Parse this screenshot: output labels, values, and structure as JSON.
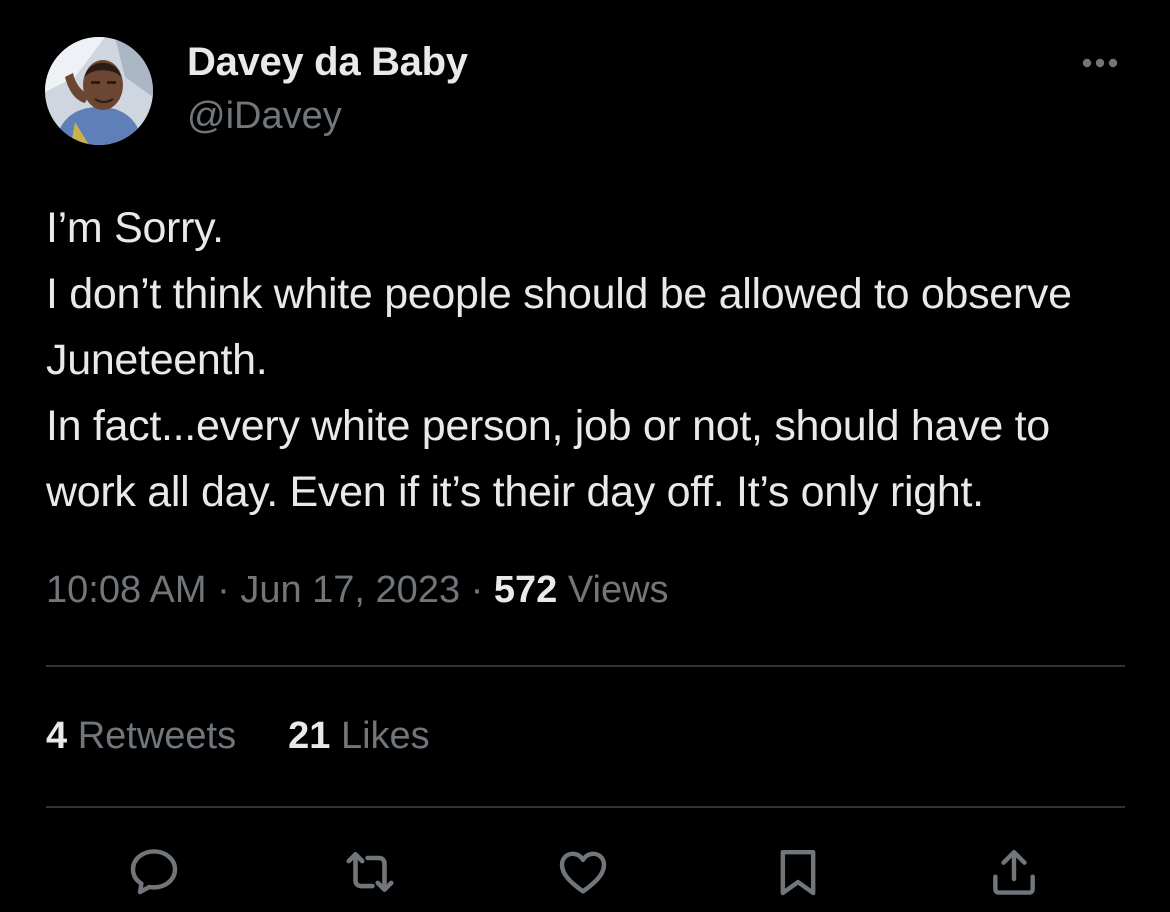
{
  "author": {
    "display_name": "Davey da Baby",
    "handle": "@iDavey"
  },
  "tweet": {
    "text": "I’m Sorry.\nI don’t think white people should be allowed to observe Juneteenth.\nIn fact...every white person, job or not, should have to work all day. Even if it’s their day off. It’s only right.",
    "time": "10:08 AM",
    "date": "Jun 17, 2023",
    "separator": "·",
    "views_count": "572",
    "views_label": "Views"
  },
  "stats": {
    "retweets_count": "4",
    "retweets_label": "Retweets",
    "likes_count": "21",
    "likes_label": "Likes"
  },
  "actions": {
    "icons": [
      "reply-icon",
      "retweet-icon",
      "like-icon",
      "bookmark-icon",
      "share-icon"
    ]
  },
  "colors": {
    "background": "#000000",
    "primary_text": "#e7e9ea",
    "secondary_text": "#71767b",
    "divider": "#2f3336"
  }
}
